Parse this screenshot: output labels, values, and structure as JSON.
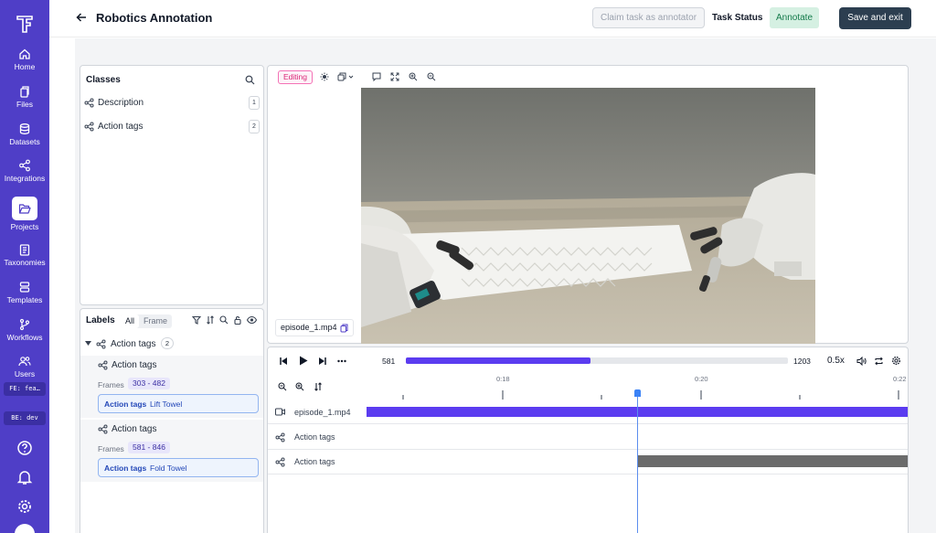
{
  "header": {
    "title": "Robotics Annotation",
    "claim_button": "Claim task as annotator",
    "task_status_label": "Task Status",
    "task_status_value": "Annotate",
    "save_button": "Save and exit"
  },
  "sidebar": {
    "items": [
      {
        "label": "Home",
        "icon": "home-icon"
      },
      {
        "label": "Files",
        "icon": "files-icon"
      },
      {
        "label": "Datasets",
        "icon": "database-icon"
      },
      {
        "label": "Integrations",
        "icon": "share-nodes-icon"
      },
      {
        "label": "Projects",
        "icon": "folder-open-icon"
      },
      {
        "label": "Taxonomies",
        "icon": "clipboard-icon"
      },
      {
        "label": "Templates",
        "icon": "stack-icon"
      },
      {
        "label": "Workflows",
        "icon": "git-branch-icon"
      },
      {
        "label": "Users",
        "icon": "users-icon"
      }
    ],
    "fe_badge": "FE: fea…",
    "be_badge": "BE: dev",
    "accent": "#4f3ec7"
  },
  "classes_panel": {
    "title": "Classes",
    "items": [
      {
        "label": "Description",
        "count": "1"
      },
      {
        "label": "Action tags",
        "count": "2"
      }
    ]
  },
  "labels_panel": {
    "title": "Labels",
    "filter_all": "All",
    "filter_frame": "Frame",
    "group": {
      "label": "Action tags",
      "count": "2"
    },
    "entries": [
      {
        "label": "Action tags",
        "frames_label": "Frames",
        "frames": "303 - 482",
        "tag_key": "Action tags",
        "tag_value": "Lift Towel"
      },
      {
        "label": "Action tags",
        "frames_label": "Frames",
        "frames": "581 - 846",
        "tag_key": "Action tags",
        "tag_value": "Fold Towel"
      }
    ]
  },
  "viewer": {
    "mode_badge": "Editing",
    "file_name": "episode_1.mp4"
  },
  "player": {
    "current_frame": "581",
    "total_frames": "1203",
    "progress": 0.4829,
    "speed": "0.5x"
  },
  "timeline": {
    "ticks": [
      "0:18",
      "0:20",
      "0:22"
    ],
    "rows": [
      {
        "label": "episode_1.mp4",
        "color": "#5b3cf0"
      },
      {
        "label": "Action tags"
      },
      {
        "label": "Action tags",
        "color": "#6b6b6b"
      }
    ]
  }
}
